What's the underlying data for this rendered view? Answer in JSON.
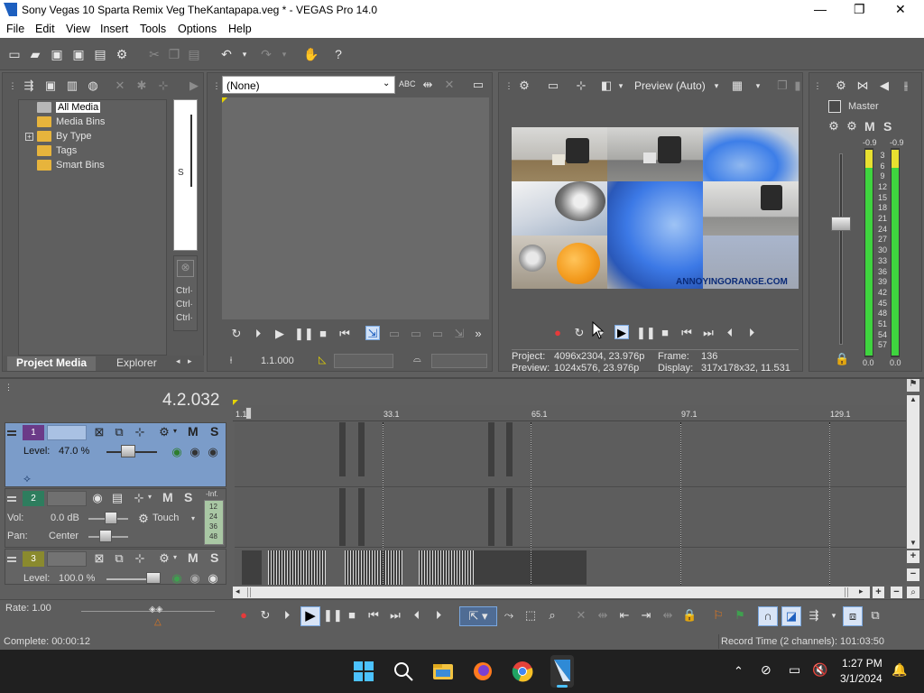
{
  "window": {
    "title": "Sony Vegas 10 Sparta Remix Veg TheKantapapa.veg * - VEGAS Pro 14.0",
    "minimize": "—",
    "maximize": "❐",
    "close": "✕"
  },
  "menu": [
    "File",
    "Edit",
    "View",
    "Insert",
    "Tools",
    "Options",
    "Help"
  ],
  "media_tree": {
    "items": [
      {
        "label": "All Media",
        "selected": true
      },
      {
        "label": "Media Bins"
      },
      {
        "label": "By Type",
        "expander": "+"
      },
      {
        "label": "Tags"
      },
      {
        "label": "Smart Bins"
      }
    ],
    "side_text": [
      "S",
      "Ctrl·",
      "Ctrl·",
      "Ctrl·"
    ],
    "tabs": {
      "project_media": "Project Media",
      "explorer": "Explorer"
    }
  },
  "trimmer": {
    "dropdown_value": "(None)",
    "timecode": "1.1.000"
  },
  "preview": {
    "quality": "Preview (Auto)",
    "project_label": "Project:",
    "project_value": "4096x2304, 23.976p",
    "preview_label": "Preview:",
    "preview_value": "1024x576, 23.976p",
    "frame_label": "Frame:",
    "frame_value": "136",
    "display_label": "Display:",
    "display_value": "317x178x32, 11.531",
    "caption": "ANNOYINGORANGE.COM"
  },
  "master": {
    "label": "Master",
    "peak_left": "-0.9",
    "peak_right": "-0.9",
    "scale": [
      "3",
      "6",
      "9",
      "12",
      "15",
      "18",
      "21",
      "24",
      "27",
      "30",
      "33",
      "36",
      "39",
      "42",
      "45",
      "48",
      "51",
      "54",
      "57"
    ],
    "bottom_left": "0.0",
    "bottom_right": "0.0",
    "m": "M",
    "s": "S"
  },
  "timeline": {
    "position": "4.2.032",
    "ruler": [
      "1.1",
      "33.1",
      "65.1",
      "97.1",
      "129.1"
    ]
  },
  "tracks": [
    {
      "number": "1",
      "level_label": "Level:",
      "level_value": "47.0 %",
      "m": "M",
      "s": "S"
    },
    {
      "number": "2",
      "vol_label": "Vol:",
      "vol_value": "0.0 dB",
      "pan_label": "Pan:",
      "pan_value": "Center",
      "mode": "Touch",
      "m": "M",
      "s": "S",
      "meter_top": "-Inf.",
      "meter_scale": [
        "12",
        "24",
        "36",
        "48"
      ]
    },
    {
      "number": "3",
      "level_label": "Level:",
      "level_value": "100.0 %",
      "m": "M",
      "s": "S"
    }
  ],
  "transport": {
    "rate": "Rate: 1.00"
  },
  "status": {
    "complete": "Complete: 00:00:12",
    "record_time": "Record Time (2 channels): 101:03:50"
  },
  "taskbar": {
    "time": "1:27 PM",
    "date": "3/1/2024"
  },
  "colors": {
    "background": "#5f5f5f",
    "video_track": "#7b9cc9",
    "audio_track": "#6a6a6a",
    "folder": "#e7b43c",
    "meter_green": "#3fd43f",
    "meter_yellow": "#e8e030",
    "play_button_bg": "#d8e4f6"
  }
}
